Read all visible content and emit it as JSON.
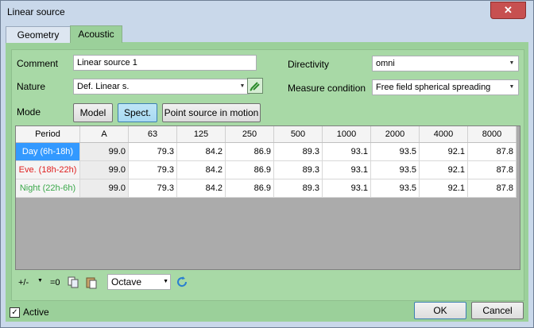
{
  "window": {
    "title": "Linear source",
    "close_glyph": "✕"
  },
  "tabs": [
    {
      "label": "Geometry"
    },
    {
      "label": "Acoustic"
    }
  ],
  "form": {
    "comment_label": "Comment",
    "comment_value": "Linear source 1",
    "nature_label": "Nature",
    "nature_value": "Def. Linear s.",
    "directivity_label": "Directivity",
    "directivity_value": "omni",
    "measure_label": "Measure condition",
    "measure_value": "Free field spherical spreading",
    "mode_label": "Mode",
    "mode_buttons": [
      "Model",
      "Spect.",
      "Point source in motion"
    ],
    "mode_selected": "Spect."
  },
  "table": {
    "headers": [
      "Period",
      "A",
      "63",
      "125",
      "250",
      "500",
      "1000",
      "2000",
      "4000",
      "8000"
    ],
    "rows": [
      {
        "period": "Day (6h-18h)",
        "color": "#ffffff",
        "values": [
          "99.0",
          "79.3",
          "84.2",
          "86.9",
          "89.3",
          "93.1",
          "93.5",
          "92.1",
          "87.8"
        ]
      },
      {
        "period": "Eve. (18h-22h)",
        "color": "#e02020",
        "values": [
          "99.0",
          "79.3",
          "84.2",
          "86.9",
          "89.3",
          "93.1",
          "93.5",
          "92.1",
          "87.8"
        ]
      },
      {
        "period": "Night (22h-6h)",
        "color": "#3aa84a",
        "values": [
          "99.0",
          "79.3",
          "84.2",
          "86.9",
          "89.3",
          "93.1",
          "93.5",
          "92.1",
          "87.8"
        ]
      }
    ]
  },
  "toolbar": {
    "plus_minus": "+/-",
    "zero": "=0",
    "band_value": "Octave",
    "icons": [
      "copy-icon",
      "paste-icon",
      "refresh-icon"
    ]
  },
  "footer": {
    "active_label": "Active",
    "active_checked": true,
    "ok_label": "OK",
    "cancel_label": "Cancel"
  },
  "colors": {
    "selected_row": "#3399ff",
    "panel_bg": "#a8d9a6",
    "accent": "#3c7fb1"
  }
}
